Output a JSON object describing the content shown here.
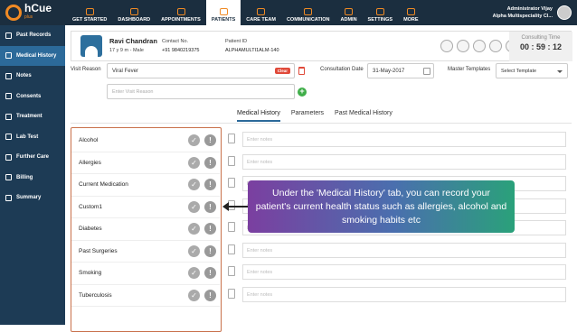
{
  "logo": {
    "name": "hCue",
    "sub": "plus"
  },
  "nav": [
    {
      "label": "GET STARTED",
      "active": false
    },
    {
      "label": "DASHBOARD",
      "active": false
    },
    {
      "label": "APPOINTMENTS",
      "active": false
    },
    {
      "label": "PATIENTS",
      "active": true
    },
    {
      "label": "CARE TEAM",
      "active": false
    },
    {
      "label": "COMMUNICATION",
      "active": false
    },
    {
      "label": "ADMIN",
      "active": false
    },
    {
      "label": "SETTINGS",
      "active": false
    },
    {
      "label": "MORE",
      "active": false
    }
  ],
  "admin": {
    "name": "Administrator Vijay",
    "clinic": "Alpha Multispeciality Cl..."
  },
  "sidebar": [
    {
      "label": "Past Records",
      "active": false
    },
    {
      "label": "Medical History",
      "active": true
    },
    {
      "label": "Notes",
      "active": false
    },
    {
      "label": "Consents",
      "active": false
    },
    {
      "label": "Treatment",
      "active": false
    },
    {
      "label": "Lab Test",
      "active": false
    },
    {
      "label": "Further Care",
      "active": false
    },
    {
      "label": "Billing",
      "active": false
    },
    {
      "label": "Summary",
      "active": false
    }
  ],
  "patient": {
    "name": "Ravi Chandran",
    "sub": "17 y 9 m - Male",
    "contact_label": "Contact No.",
    "contact": "+91 9840219375",
    "id_label": "Patient ID",
    "id": "ALPHAMULTI1ALM-140"
  },
  "timer": {
    "label": "Consulting Time",
    "value": "00 : 59 : 12"
  },
  "visit": {
    "label": "Visit Reason",
    "value": "Viral Fever",
    "clear": "Clear",
    "placeholder": "Enter Visit Reason"
  },
  "consultation": {
    "label": "Consultation Date",
    "value": "31-May-2017"
  },
  "templates": {
    "label": "Master Templates",
    "value": "Select Template"
  },
  "tabs": [
    {
      "label": "Medical History",
      "active": true
    },
    {
      "label": "Parameters",
      "active": false
    },
    {
      "label": "Past Medical History",
      "active": false
    }
  ],
  "history": [
    "Alcohol",
    "Allergies",
    "Current Medication",
    "Custom1",
    "Diabetes",
    "Past Surgeries",
    "Smoking",
    "Tuberculosis"
  ],
  "notes_placeholder": "Enter notes",
  "callout": "Under the 'Medical History' tab, you can record your patient's current health status such as allergies, alcohol and smoking habits etc"
}
